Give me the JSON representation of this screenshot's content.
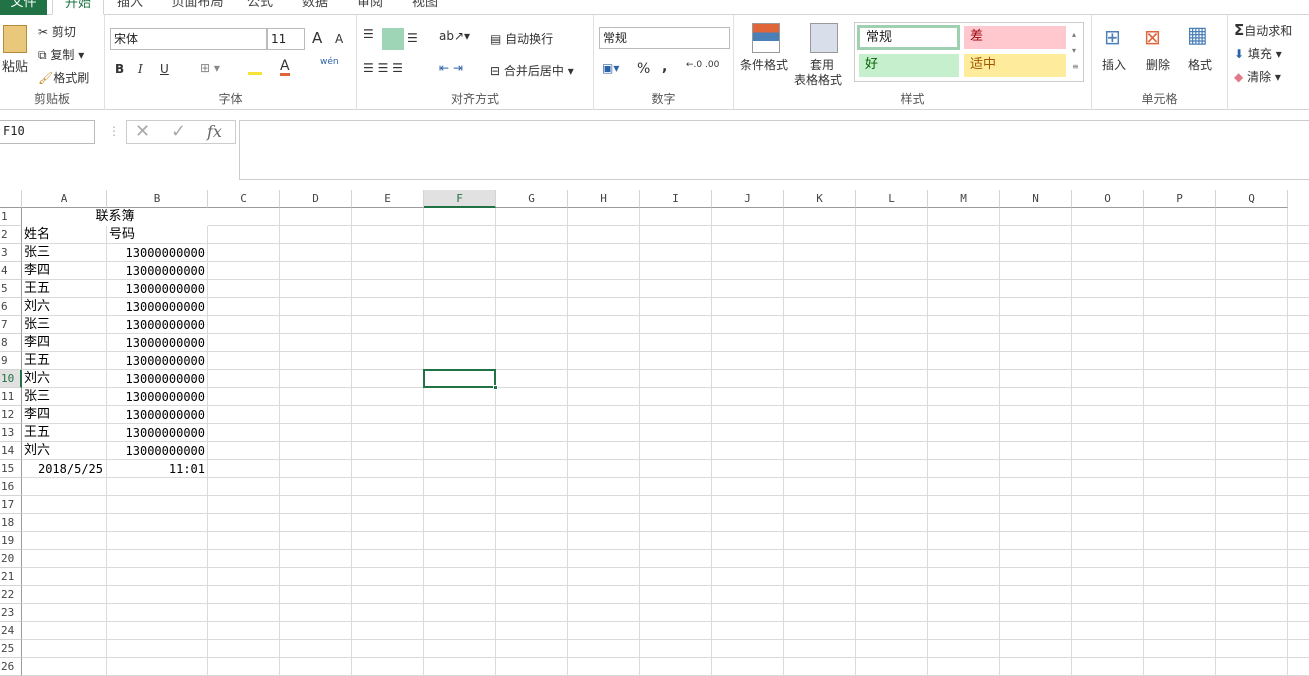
{
  "tabs": [
    "文件",
    "开始",
    "插入",
    "页面布局",
    "公式",
    "数据",
    "审阅",
    "视图"
  ],
  "clipboard": {
    "paste": "粘贴",
    "cut": "剪切",
    "copy": "复制",
    "format_painter": "格式刷",
    "label": "剪贴板"
  },
  "font": {
    "name": "宋体",
    "size": "11",
    "bold": "B",
    "italic": "I",
    "underline": "U",
    "phonetic": "wén",
    "label": "字体"
  },
  "alignment": {
    "wrap": "自动换行",
    "merge": "合并后居中",
    "label": "对齐方式"
  },
  "number": {
    "format": "常规",
    "percent": "%",
    "comma": ",",
    "label": "数字"
  },
  "styles": {
    "conditional": "条件格式",
    "table1": "套用",
    "table2": "表格格式",
    "normal": "常规",
    "bad": "差",
    "good": "好",
    "neutral": "适中",
    "label": "样式"
  },
  "cells": {
    "insert": "插入",
    "delete": "删除",
    "format": "格式",
    "label": "单元格"
  },
  "editing": {
    "autosum": "自动求和",
    "fill": "填充",
    "clear": "清除"
  },
  "formula_bar": {
    "name_box": "F10",
    "fx": "fx",
    "content": ""
  },
  "columns": [
    "A",
    "B",
    "C",
    "D",
    "E",
    "F",
    "G",
    "H",
    "I",
    "J",
    "K",
    "L",
    "M",
    "N",
    "O",
    "P",
    "Q"
  ],
  "selected": {
    "col": "F",
    "row": 10
  },
  "rows": [
    {
      "n": 1,
      "a": "",
      "b": "",
      "title": "联系簿"
    },
    {
      "n": 2,
      "a": "姓名",
      "b": "号码"
    },
    {
      "n": 3,
      "a": "张三",
      "b": "13000000000"
    },
    {
      "n": 4,
      "a": "李四",
      "b": "13000000000"
    },
    {
      "n": 5,
      "a": "王五",
      "b": "13000000000"
    },
    {
      "n": 6,
      "a": "刘六",
      "b": "13000000000"
    },
    {
      "n": 7,
      "a": "张三",
      "b": "13000000000"
    },
    {
      "n": 8,
      "a": "李四",
      "b": "13000000000"
    },
    {
      "n": 9,
      "a": "王五",
      "b": "13000000000"
    },
    {
      "n": 10,
      "a": "刘六",
      "b": "13000000000"
    },
    {
      "n": 11,
      "a": "张三",
      "b": "13000000000"
    },
    {
      "n": 12,
      "a": "李四",
      "b": "13000000000"
    },
    {
      "n": 13,
      "a": "王五",
      "b": "13000000000"
    },
    {
      "n": 14,
      "a": "刘六",
      "b": "13000000000"
    },
    {
      "n": 15,
      "a": "2018/5/25",
      "b": "11:01"
    },
    {
      "n": 16
    },
    {
      "n": 17
    },
    {
      "n": 18
    },
    {
      "n": 19
    },
    {
      "n": 20
    },
    {
      "n": 21
    },
    {
      "n": 22
    },
    {
      "n": 23
    },
    {
      "n": 24
    },
    {
      "n": 25
    },
    {
      "n": 26
    }
  ]
}
